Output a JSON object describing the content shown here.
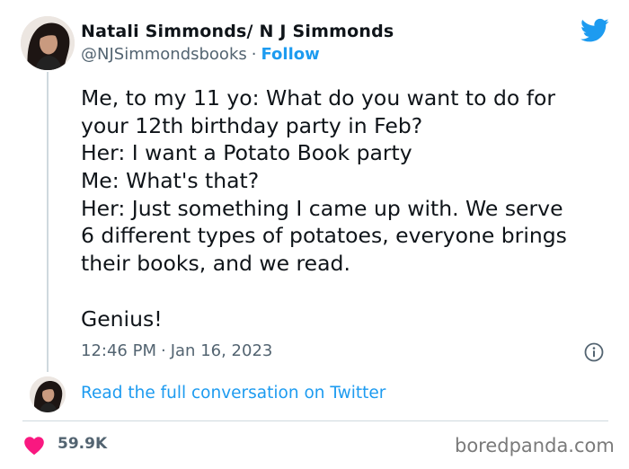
{
  "author": {
    "display_name": "Natali Simmonds/ N J Simmonds",
    "handle": "@NJSimmondsbooks",
    "separator": "·",
    "follow_label": "Follow"
  },
  "tweet": {
    "lines": [
      "Me, to my 11 yo: What do you want to do for",
      "your 12th birthday party in Feb?",
      "Her: I want a Potato Book party",
      "Me: What's that?",
      "Her: Just something I came up with. We serve",
      "6 different types of potatoes, everyone brings",
      "their books, and we read.",
      "",
      "Genius!"
    ],
    "time": "12:46 PM",
    "separator": "·",
    "date": "Jan 16, 2023"
  },
  "conversation_link": "Read the full conversation on Twitter",
  "likes": "59.9K",
  "watermark": "boredpanda.com",
  "icons": {
    "brand": "twitter-bird-icon",
    "info": "info-icon",
    "like": "heart-icon"
  },
  "colors": {
    "accent": "#1d9bf0",
    "like": "#f91880",
    "text": "#0f1419",
    "muted": "#536471",
    "border": "#cfd9de"
  }
}
